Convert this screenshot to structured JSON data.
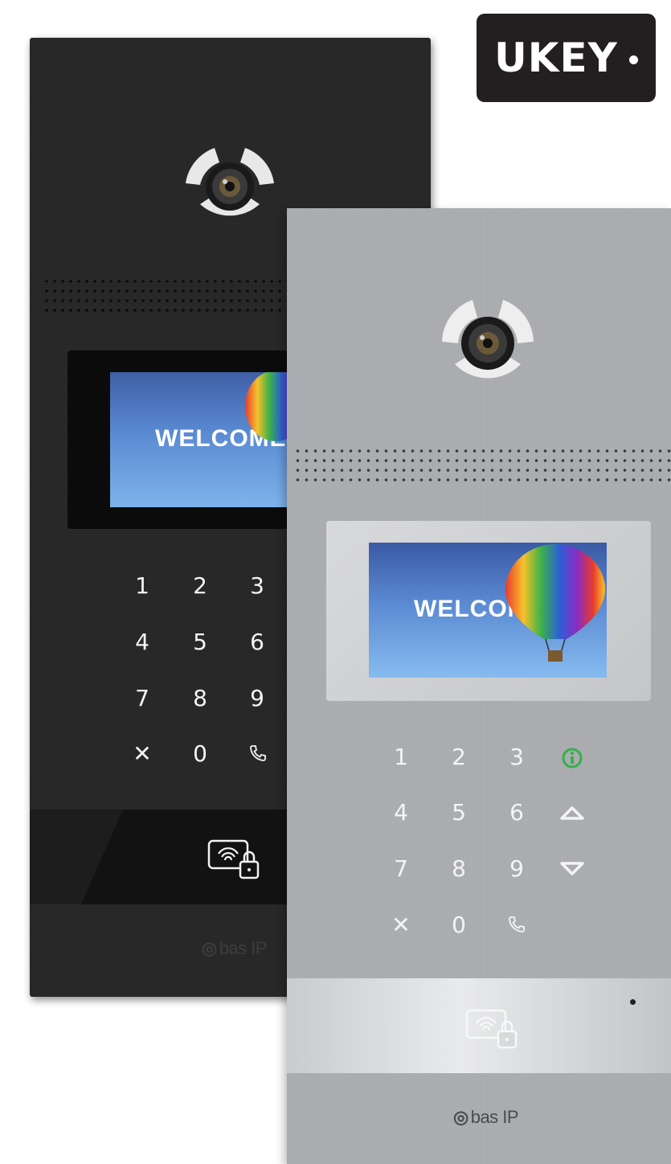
{
  "brand_badge": {
    "text": "UKEY"
  },
  "dark_panel": {
    "screen_text": "WELCOME",
    "keys": [
      "1",
      "2",
      "3",
      "4",
      "5",
      "6",
      "7",
      "8",
      "9",
      "✕",
      "0"
    ],
    "call_key": "call-icon",
    "logo": "bas IP"
  },
  "silver_panel": {
    "screen_text": "WELCOME",
    "keys": [
      "1",
      "2",
      "3",
      "4",
      "5",
      "6",
      "7",
      "8",
      "9",
      "✕",
      "0"
    ],
    "side_keys": [
      "info-icon",
      "up-icon",
      "down-icon"
    ],
    "call_key": "call-icon",
    "logo": "bas IP"
  },
  "colors": {
    "badge": "#231f20",
    "info_key": "#33b24a",
    "sky_top": "#3a5aa4",
    "sky_bottom": "#86bbef"
  }
}
